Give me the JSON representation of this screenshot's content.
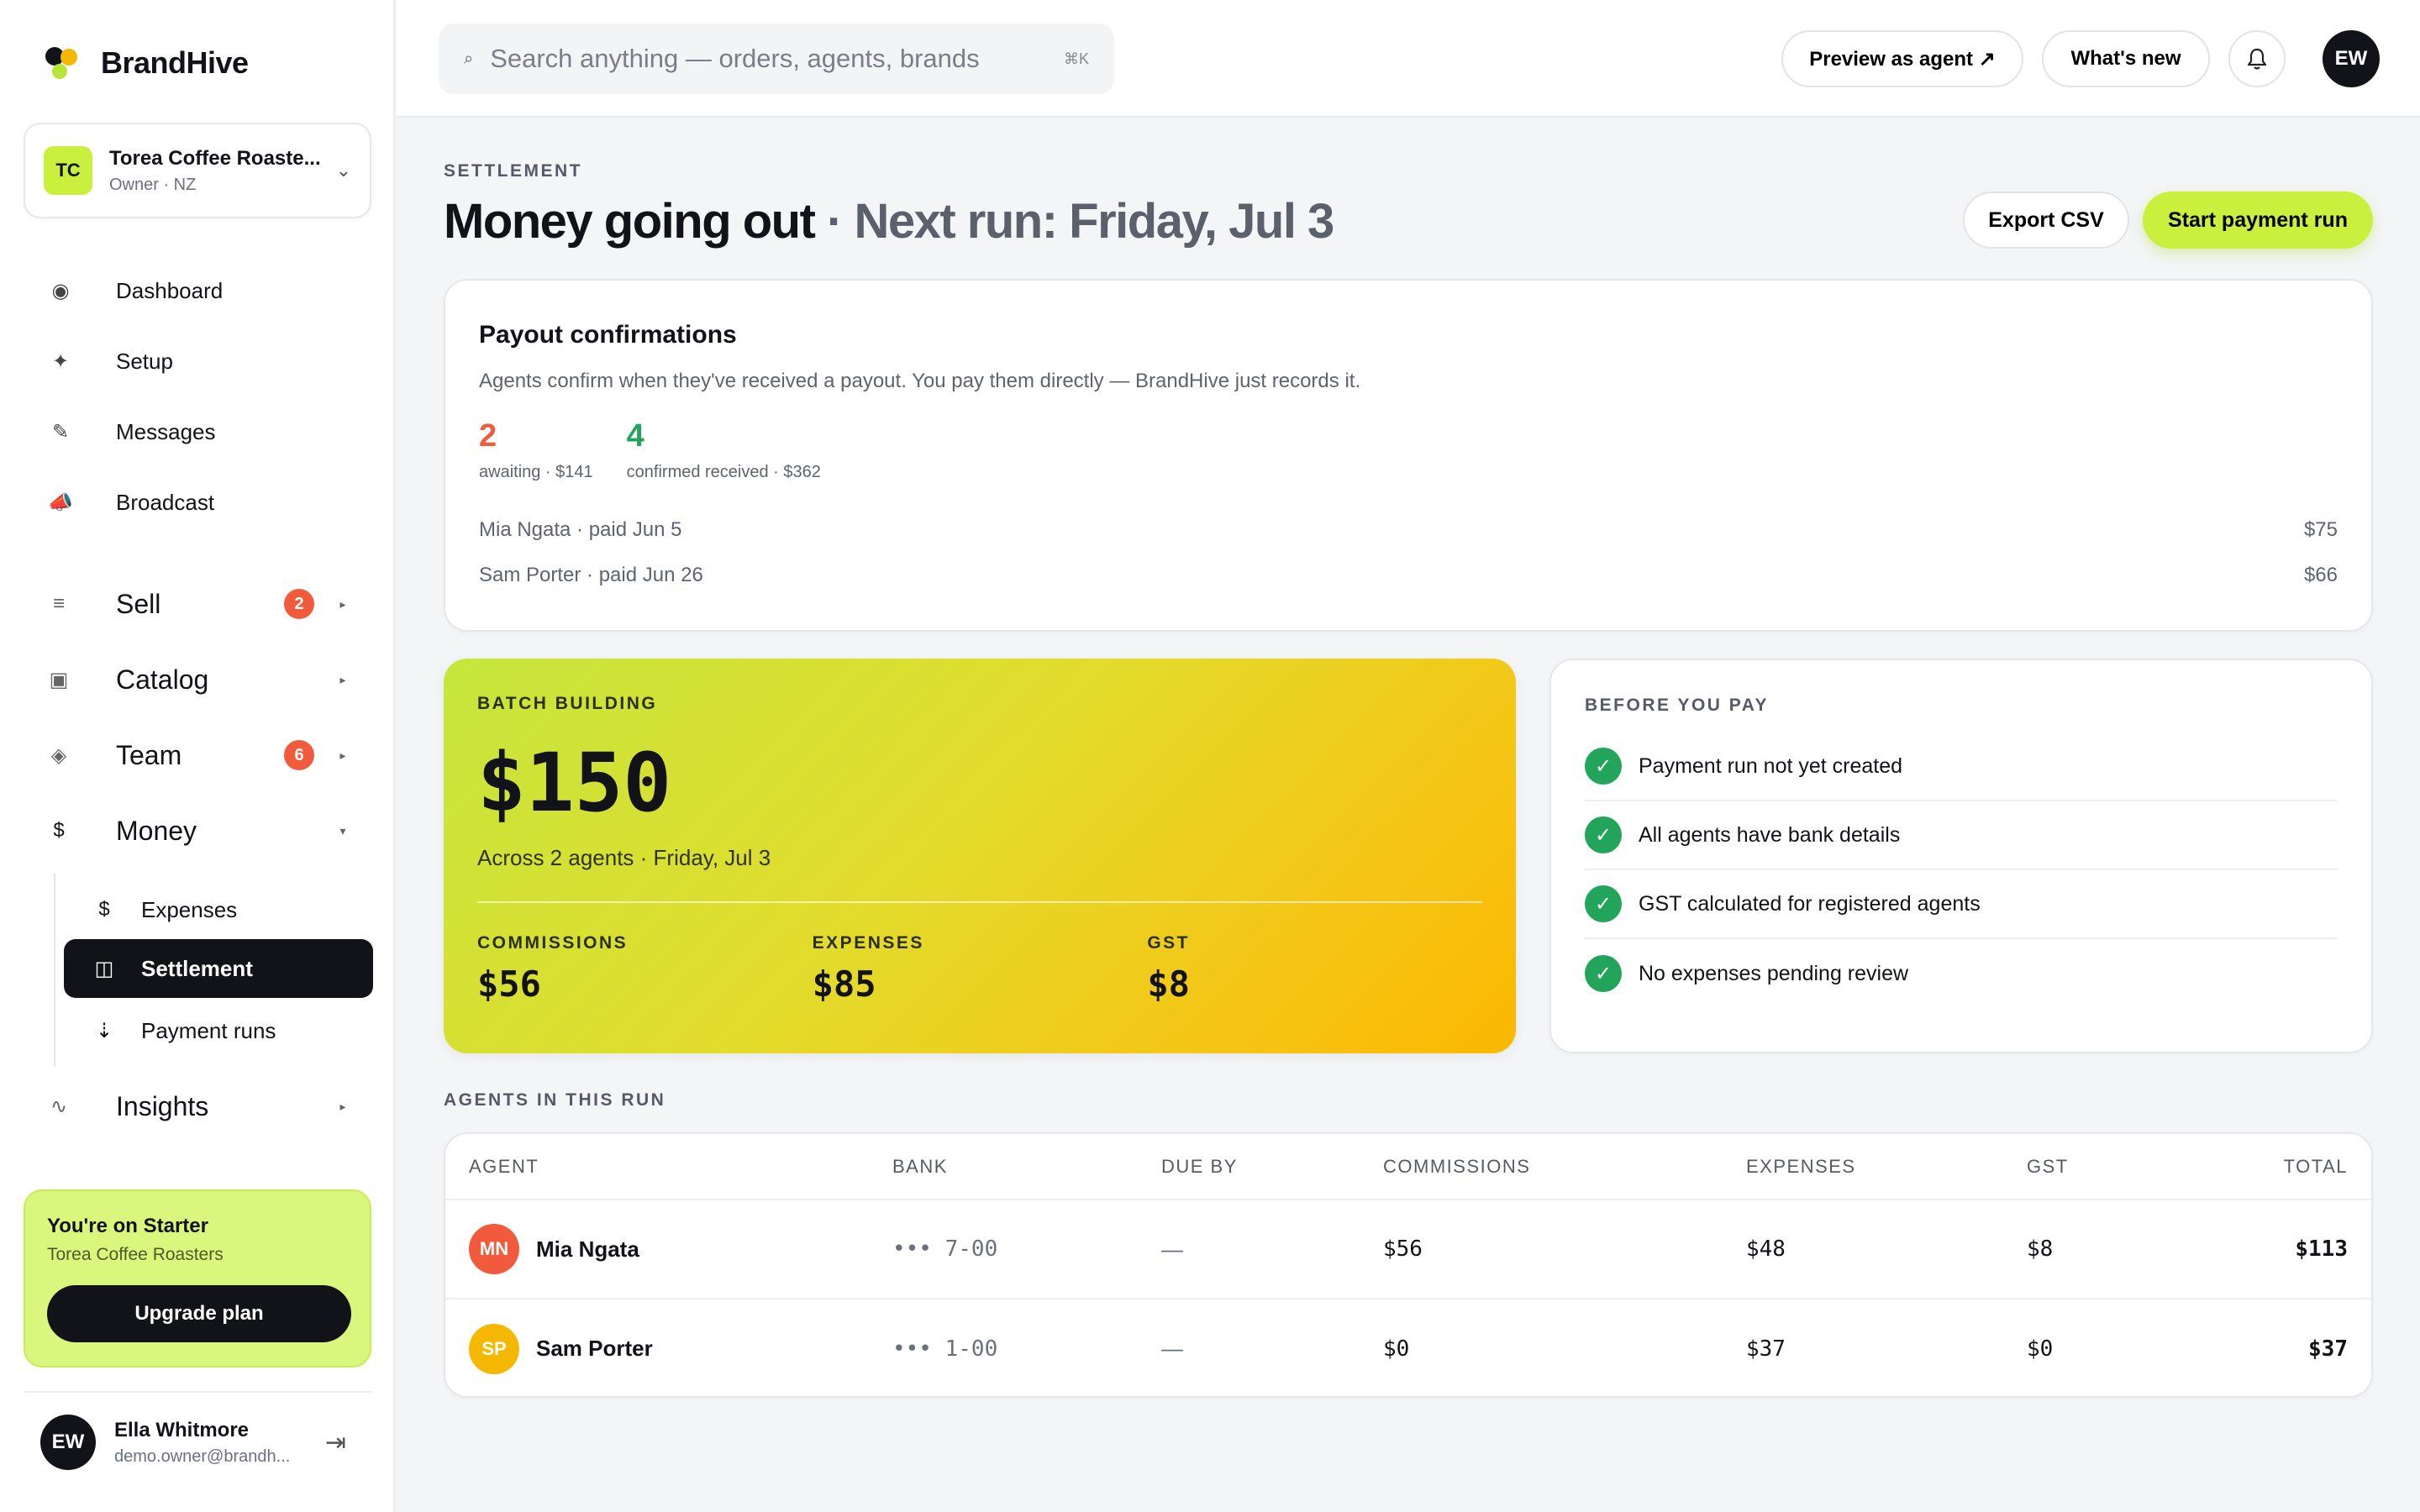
{
  "brand": {
    "name": "BrandHive"
  },
  "workspace": {
    "initials": "TC",
    "name": "Torea Coffee Roaste...",
    "role": "Owner · NZ"
  },
  "nav": {
    "top": [
      {
        "label": "Dashboard",
        "icon": "dashboard-icon",
        "glyph": "◉"
      },
      {
        "label": "Setup",
        "icon": "sparkle-icon",
        "glyph": "✦"
      },
      {
        "label": "Messages",
        "icon": "pencil-icon",
        "glyph": "✎"
      },
      {
        "label": "Broadcast",
        "icon": "megaphone-icon",
        "glyph": "📣"
      }
    ],
    "sections": [
      {
        "label": "Sell",
        "icon": "list-icon",
        "glyph": "≡",
        "badge": "2"
      },
      {
        "label": "Catalog",
        "icon": "box-icon",
        "glyph": "▣",
        "badge": ""
      },
      {
        "label": "Team",
        "icon": "diamond-icon",
        "glyph": "◈",
        "badge": "6"
      },
      {
        "label": "Money",
        "icon": "dollar-icon",
        "glyph": "$",
        "badge": ""
      },
      {
        "label": "Insights",
        "icon": "trend-icon",
        "glyph": "∿",
        "badge": ""
      }
    ],
    "money_sub": [
      {
        "label": "Expenses",
        "glyph": "$"
      },
      {
        "label": "Settlement",
        "glyph": "◫"
      },
      {
        "label": "Payment runs",
        "glyph": "⇣"
      }
    ]
  },
  "plan": {
    "title": "You're on Starter",
    "org": "Torea Coffee Roasters",
    "button": "Upgrade plan"
  },
  "user": {
    "initials": "EW",
    "name": "Ella Whitmore",
    "email": "demo.owner@brandh..."
  },
  "topbar": {
    "search_placeholder": "Search anything — orders, agents, brands",
    "shortcut": "⌘K",
    "preview_label": "Preview as agent ↗",
    "whats_new_label": "What's new",
    "avatar_initials": "EW"
  },
  "page": {
    "eyebrow": "SETTLEMENT",
    "title": "Money going out",
    "subtitle": " · Next run: Friday, Jul 3",
    "export_label": "Export CSV",
    "start_label": "Start payment run"
  },
  "payout": {
    "title": "Payout confirmations",
    "description": "Agents confirm when they've received a payout. You pay them directly — BrandHive just records it.",
    "awaiting": {
      "count": "2",
      "caption": "awaiting · $141",
      "color": "#f15a3b"
    },
    "confirmed": {
      "count": "4",
      "caption": "confirmed received · $362",
      "color": "#22a45a"
    },
    "rows": [
      {
        "label": "Mia Ngata · paid Jun 5",
        "amount": "$75"
      },
      {
        "label": "Sam Porter · paid Jun 26",
        "amount": "$66"
      }
    ]
  },
  "batch": {
    "label": "BATCH BUILDING",
    "amount": "$150",
    "meta": "Across 2 agents · Friday, Jul 3",
    "commissions_label": "COMMISSIONS",
    "commissions": "$56",
    "expenses_label": "EXPENSES",
    "expenses": "$85",
    "gst_label": "GST",
    "gst": "$8"
  },
  "before_pay": {
    "label": "BEFORE YOU PAY",
    "items": [
      "Payment run not yet created",
      "All agents have bank details",
      "GST calculated for registered agents",
      "No expenses pending review"
    ]
  },
  "agents": {
    "label": "AGENTS IN THIS RUN",
    "columns": [
      "AGENT",
      "BANK",
      "DUE BY",
      "COMMISSIONS",
      "EXPENSES",
      "GST",
      "TOTAL"
    ],
    "rows": [
      {
        "initials": "MN",
        "color": "#f15a3b",
        "name": "Mia Ngata",
        "bank": "••• 7-00",
        "due": "—",
        "commissions": "$56",
        "expenses": "$48",
        "gst": "$8",
        "total": "$113"
      },
      {
        "initials": "SP",
        "color": "#f5b800",
        "name": "Sam Porter",
        "bank": "••• 1-00",
        "due": "—",
        "commissions": "$0",
        "expenses": "$37",
        "gst": "$0",
        "total": "$37"
      }
    ]
  },
  "colors": {
    "accent": "#c8f03c",
    "dark": "#111318",
    "success": "#22a45a",
    "danger": "#f15a3b"
  }
}
